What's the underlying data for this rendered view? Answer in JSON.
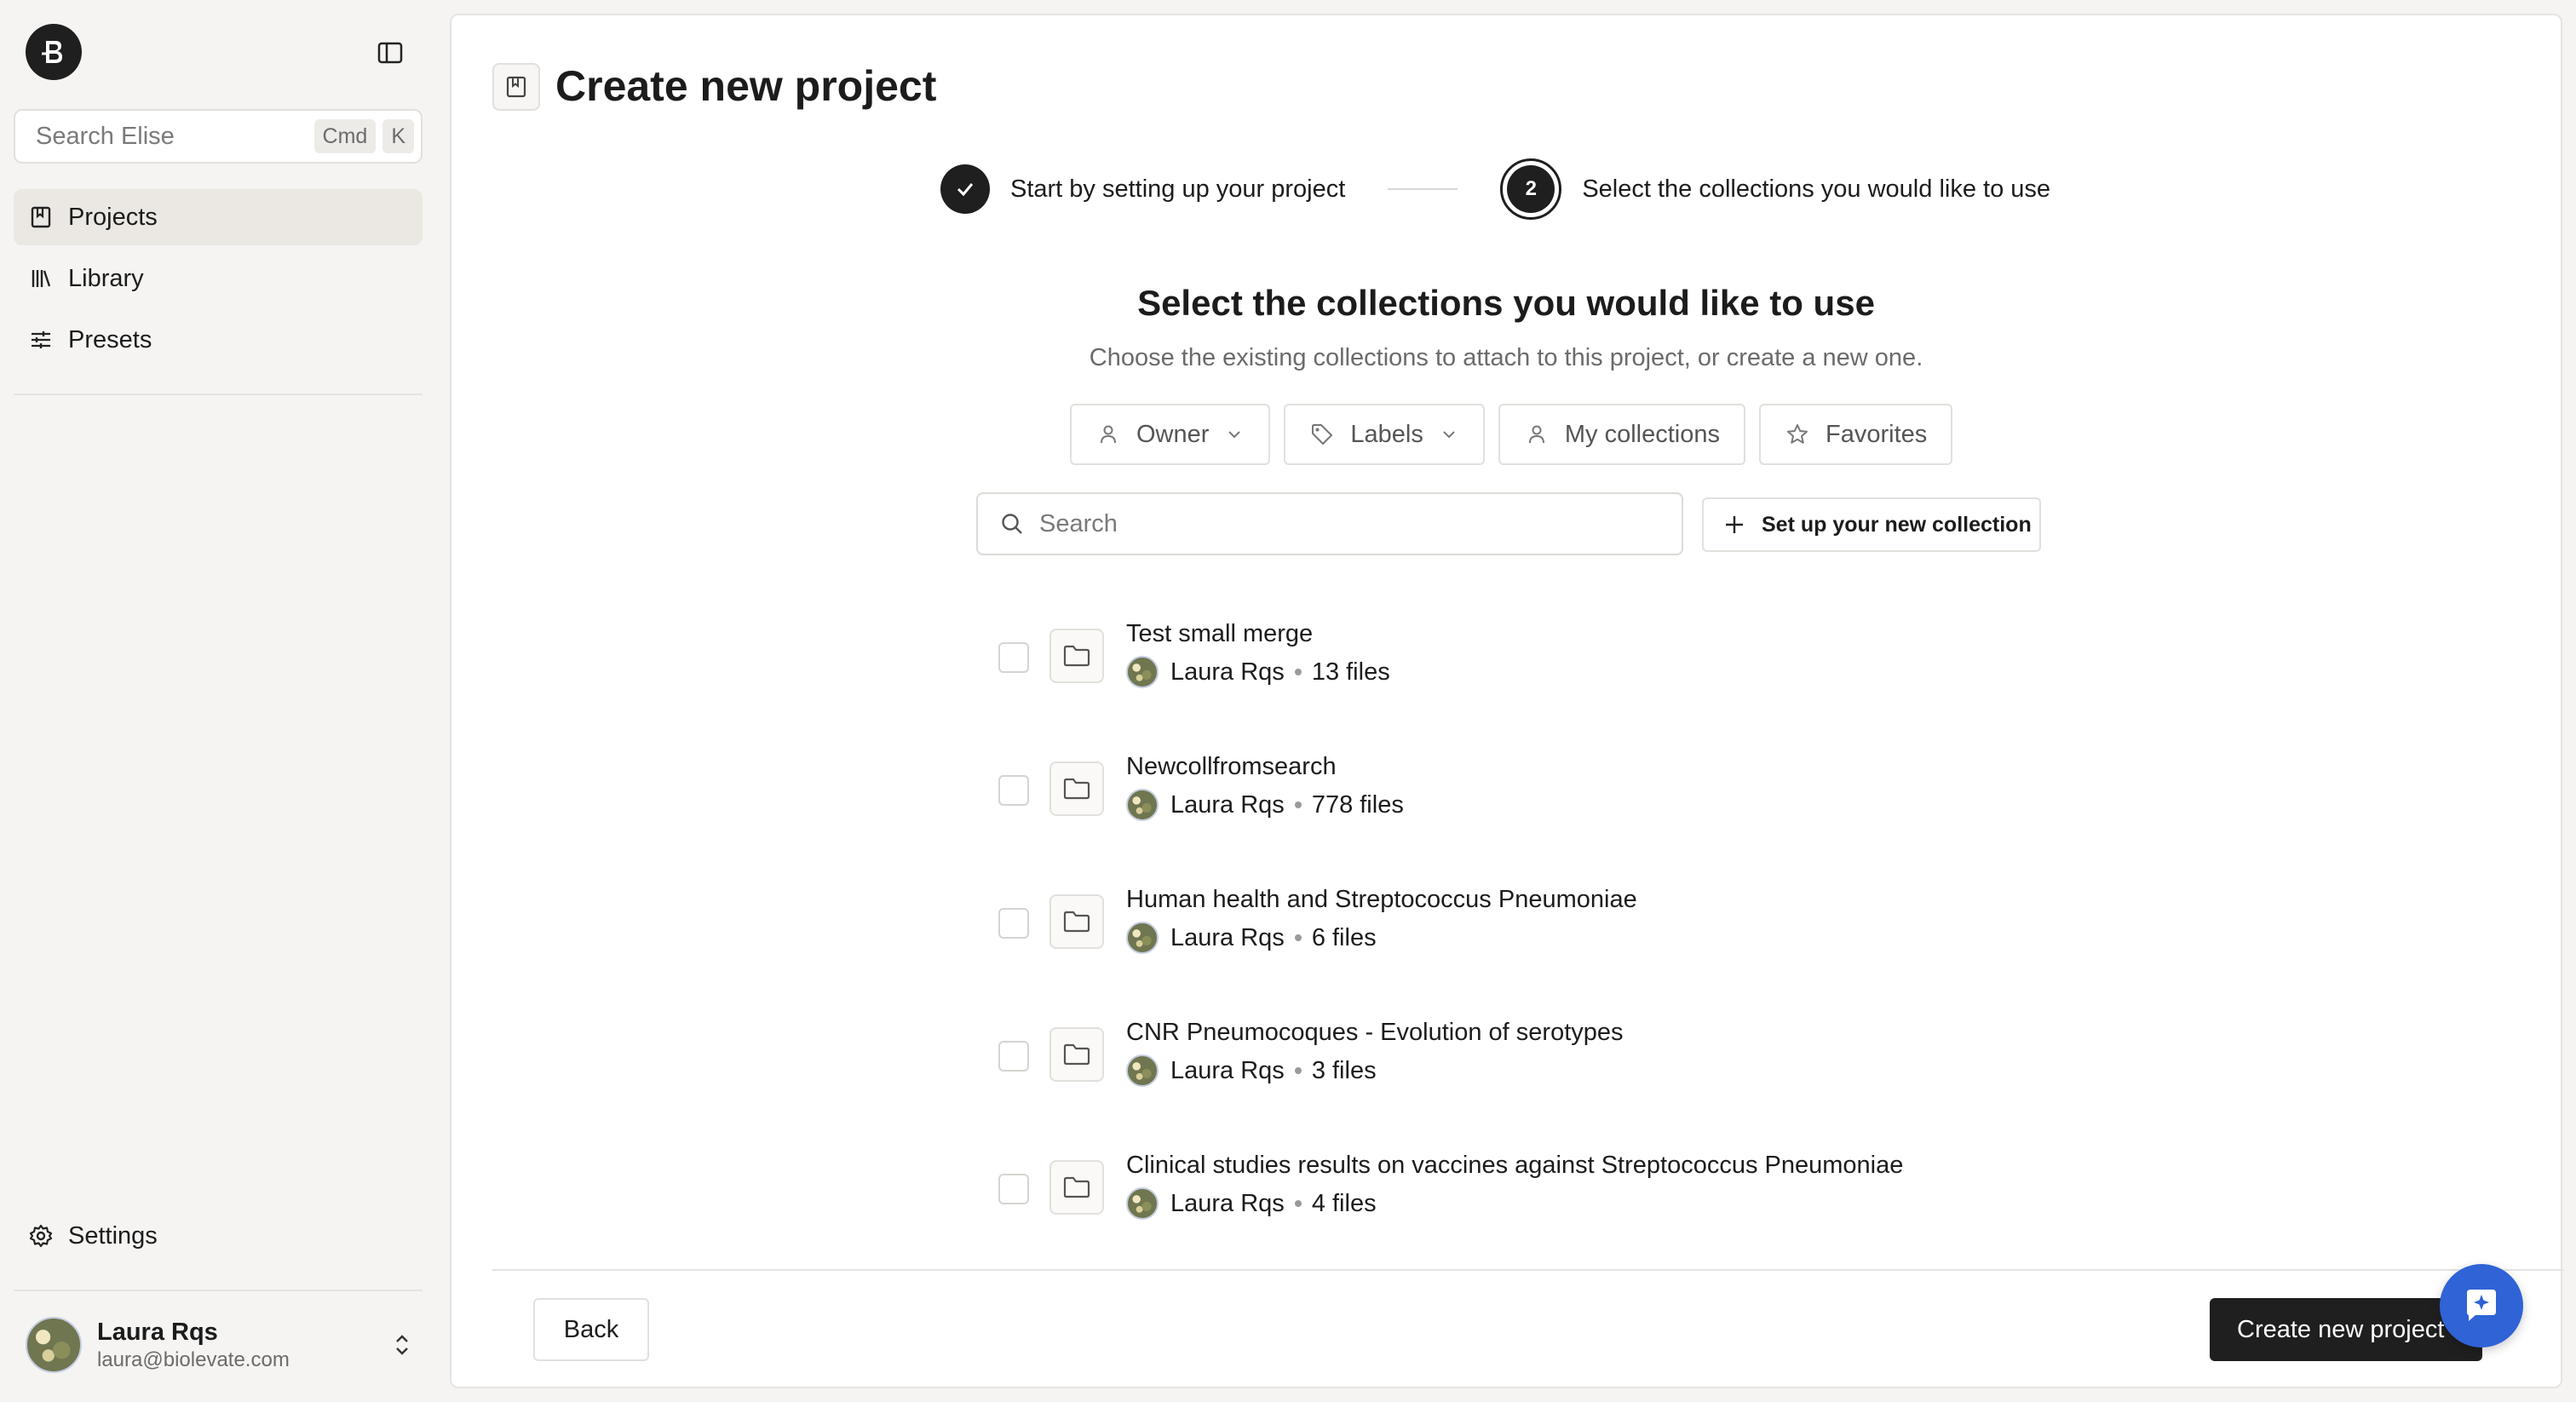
{
  "sidebar": {
    "search_placeholder": "Search Elise",
    "shortcut_cmd": "Cmd",
    "shortcut_key": "K",
    "nav": [
      {
        "label": "Projects",
        "icon": "bookmark-book-icon",
        "active": true
      },
      {
        "label": "Library",
        "icon": "library-icon",
        "active": false
      },
      {
        "label": "Presets",
        "icon": "sliders-icon",
        "active": false
      }
    ],
    "settings_label": "Settings",
    "user": {
      "name": "Laura Rqs",
      "email": "laura@biolevate.com"
    }
  },
  "main": {
    "title": "Create new project",
    "steps": [
      {
        "label": "Start by setting up your project",
        "status": "done"
      },
      {
        "number": "2",
        "label": "Select the collections you would like to use",
        "status": "current"
      }
    ],
    "section_title": "Select the collections you would like to use",
    "section_subtitle": "Choose the existing collections to attach to this project, or create a new one.",
    "filters": [
      {
        "label": "Owner",
        "icon": "user-icon",
        "dropdown": true
      },
      {
        "label": "Labels",
        "icon": "tag-icon",
        "dropdown": true
      },
      {
        "label": "My collections",
        "icon": "user-icon",
        "dropdown": false
      },
      {
        "label": "Favorites",
        "icon": "star-icon",
        "dropdown": false
      }
    ],
    "search_placeholder": "Search",
    "new_collection_label": "Set up your new collection",
    "collections": [
      {
        "name": "Test small merge",
        "owner": "Laura Rqs",
        "files": "13 files"
      },
      {
        "name": "Newcollfromsearch",
        "owner": "Laura Rqs",
        "files": "778 files"
      },
      {
        "name": "Human health and Streptococcus Pneumoniae",
        "owner": "Laura Rqs",
        "files": "6 files"
      },
      {
        "name": "CNR Pneumocoques - Evolution of serotypes",
        "owner": "Laura Rqs",
        "files": "3 files"
      },
      {
        "name": "Clinical studies results on vaccines against Streptococcus Pneumoniae",
        "owner": "Laura Rqs",
        "files": "4 files"
      }
    ],
    "back_label": "Back",
    "create_label": "Create new project"
  },
  "colors": {
    "primary": "#1f1f1f",
    "sidebar_bg": "#f5f4f2",
    "active_nav_bg": "#ebe8e3",
    "chat_button": "#2f63d6"
  }
}
